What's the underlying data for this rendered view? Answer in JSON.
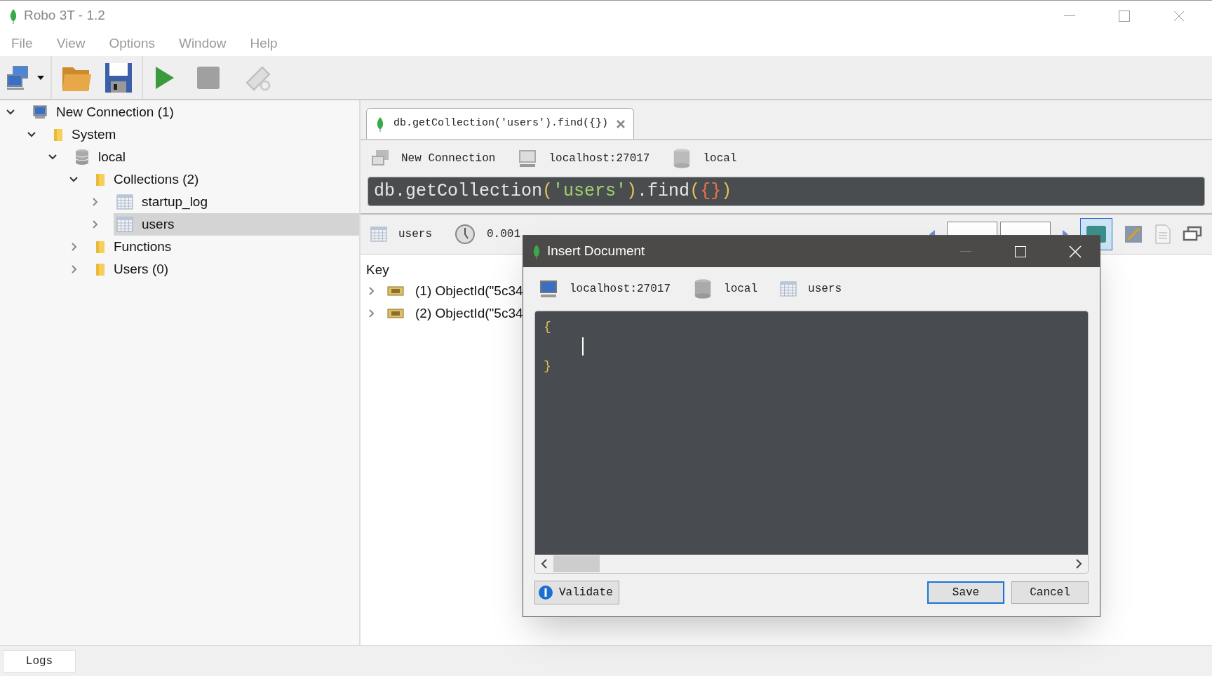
{
  "window": {
    "title": "Robo 3T - 1.2"
  },
  "menu": [
    "File",
    "View",
    "Options",
    "Window",
    "Help"
  ],
  "tree": [
    {
      "label": "New Connection (1)",
      "kind": "connection",
      "expanded": true,
      "selected": false,
      "children": [
        {
          "label": "System",
          "kind": "folder",
          "expanded": true,
          "selected": false,
          "children": [
            {
              "label": "local",
              "kind": "database",
              "expanded": true,
              "selected": false,
              "children": [
                {
                  "label": "Collections (2)",
                  "kind": "folder",
                  "expanded": true,
                  "selected": false,
                  "children": [
                    {
                      "label": "startup_log",
                      "kind": "collection",
                      "expanded": false,
                      "selected": false
                    },
                    {
                      "label": "users",
                      "kind": "collection",
                      "expanded": false,
                      "selected": true
                    }
                  ]
                },
                {
                  "label": "Functions",
                  "kind": "folder",
                  "expanded": false,
                  "selected": false
                },
                {
                  "label": "Users (0)",
                  "kind": "folder",
                  "expanded": false,
                  "selected": false
                }
              ]
            }
          ]
        }
      ]
    }
  ],
  "query_tab": {
    "label": "db.getCollection('users').find({})",
    "selected": true
  },
  "context": {
    "connection": "New Connection",
    "server": "localhost:27017",
    "database": "local"
  },
  "query": [
    {
      "text": "db.getCollection",
      "kind": "plain"
    },
    {
      "text": "(",
      "kind": "paren"
    },
    {
      "text": "'users'",
      "kind": "string"
    },
    {
      "text": ")",
      "kind": "paren"
    },
    {
      "text": ".find",
      "kind": "plain"
    },
    {
      "text": "(",
      "kind": "paren"
    },
    {
      "text": "{}",
      "kind": "brace"
    },
    {
      "text": ")",
      "kind": "paren"
    }
  ],
  "results": {
    "collection": "users",
    "time": "0.001",
    "column": "Key",
    "rows": [
      "(1) ObjectId(\"5c34",
      "(2) ObjectId(\"5c34"
    ]
  },
  "dialog": {
    "title": "Insert Document",
    "server": "localhost:27017",
    "database": "local",
    "collection": "users",
    "lines": [
      "{",
      "}"
    ],
    "validate": "Validate",
    "save": "Save",
    "cancel": "Cancel"
  },
  "logs_tab": "Logs"
}
